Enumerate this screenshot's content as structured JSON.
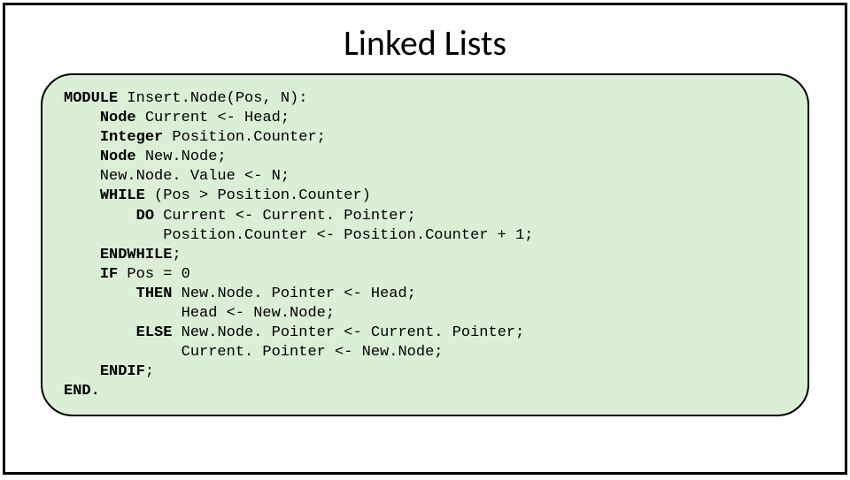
{
  "title": "Linked Lists",
  "code": {
    "kw_module": "MODULE",
    "t_module": " Insert.Node(Pos, N):",
    "kw_node1": "Node",
    "t_node1": " Current <- Head;",
    "kw_integer": "Integer",
    "t_integer": " Position.Counter;",
    "kw_node2": "Node",
    "t_node2": " New.Node;",
    "t_assign1": "    New.Node. Value <- N;",
    "kw_while": "WHILE",
    "t_while": " (Pos > Position.Counter)",
    "kw_do": "DO",
    "t_do": " Current <- Current. Pointer;",
    "t_poscnt": "           Position.Counter <- Position.Counter + 1;",
    "kw_endwhile": "ENDWHILE",
    "t_endwhile": ";",
    "kw_if": "IF",
    "t_if": " Pos = 0",
    "kw_then": "THEN",
    "t_then": " New.Node. Pointer <- Head;",
    "t_head": "             Head <- New.Node;",
    "kw_else": "ELSE",
    "t_else": " New.Node. Pointer <- Current. Pointer;",
    "t_curr": "             Current. Pointer <- New.Node;",
    "kw_endif": "ENDIF",
    "t_endif": ";",
    "kw_end": "END."
  }
}
